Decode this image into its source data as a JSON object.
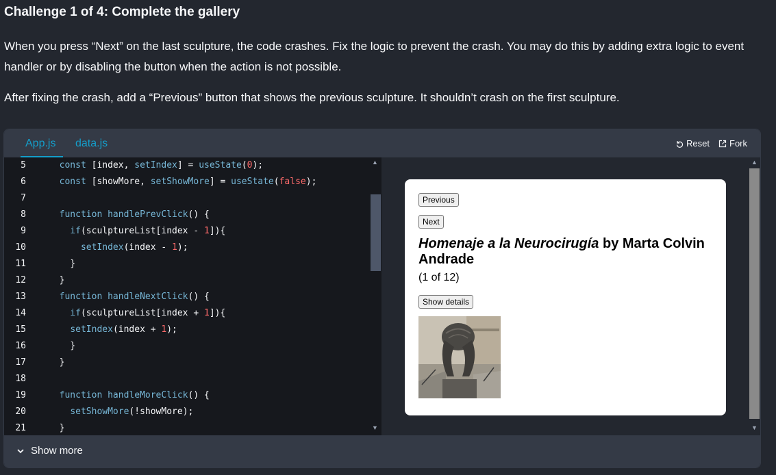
{
  "heading": {
    "prefix": "Challenge 1 of 4:",
    "title": "Complete the gallery"
  },
  "paragraphs": [
    "When you press “Next” on the last sculpture, the code crashes. Fix the logic to prevent the crash. You may do this by adding extra logic to event handler or by disabling the button when the action is not possible.",
    "After fixing the crash, add a “Previous” button that shows the previous sculpture. It shouldn’t crash on the first sculpture."
  ],
  "tabs": [
    "App.js",
    "data.js"
  ],
  "toolbar": {
    "reset": "Reset",
    "fork": "Fork"
  },
  "code_lines": [
    {
      "n": "5",
      "t": "  const [index, setIndex] = useState(0);"
    },
    {
      "n": "6",
      "t": "  const [showMore, setShowMore] = useState(false);"
    },
    {
      "n": "7",
      "t": ""
    },
    {
      "n": "8",
      "t": "  function handlePrevClick() {"
    },
    {
      "n": "9",
      "t": "    if(sculptureList[index - 1]){"
    },
    {
      "n": "10",
      "t": "      setIndex(index - 1);"
    },
    {
      "n": "11",
      "t": "    }"
    },
    {
      "n": "12",
      "t": "  }"
    },
    {
      "n": "13",
      "t": "  function handleNextClick() {"
    },
    {
      "n": "14",
      "t": "    if(sculptureList[index + 1]){"
    },
    {
      "n": "15",
      "t": "    setIndex(index + 1);"
    },
    {
      "n": "16",
      "t": "    }"
    },
    {
      "n": "17",
      "t": "  }"
    },
    {
      "n": "18",
      "t": ""
    },
    {
      "n": "19",
      "t": "  function handleMoreClick() {"
    },
    {
      "n": "20",
      "t": "    setShowMore(!showMore);"
    },
    {
      "n": "21",
      "t": "  }"
    }
  ],
  "preview": {
    "prev_label": "Previous",
    "next_label": "Next",
    "sculpture_name": "Homenaje a la Neurocirugía",
    "by": " by Marta Colvin Andrade",
    "counter": "(1 of 12)",
    "details_label": "Show details"
  },
  "footer": {
    "label": "Show more"
  },
  "colors": {
    "page_bg": "#23272f",
    "panel_bg": "#343a46",
    "editor_bg": "#16181d",
    "accent": "#149eca",
    "keyword": "#77b7d7",
    "number": "#ff6b6b"
  }
}
